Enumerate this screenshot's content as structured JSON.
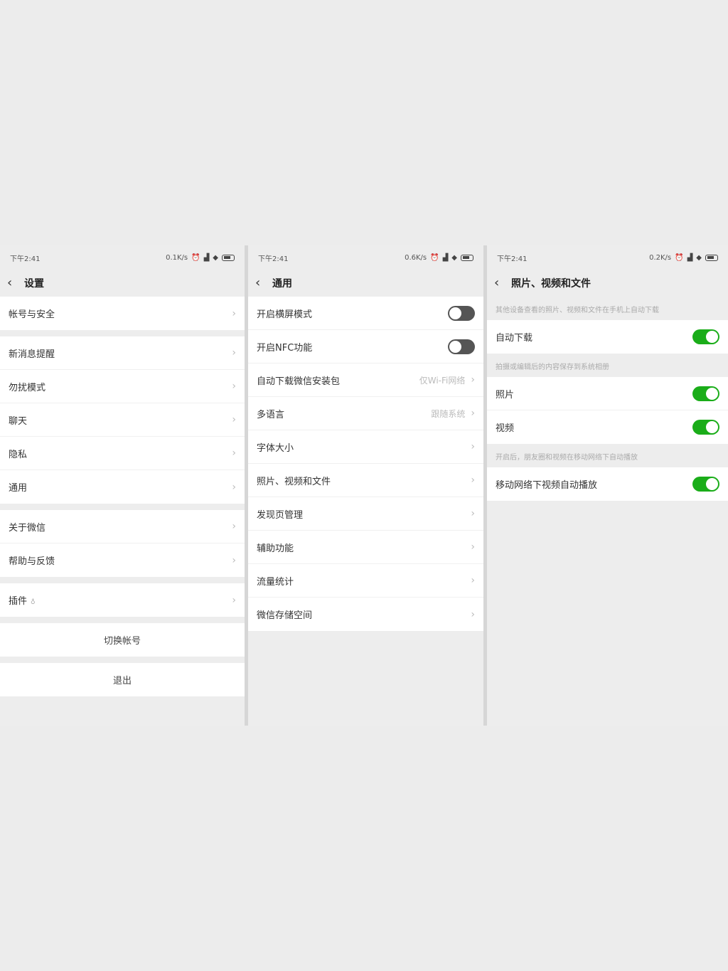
{
  "panel1": {
    "status": {
      "time": "下午2:41",
      "speed": "0.1K/s"
    },
    "nav": {
      "title": "设置"
    },
    "groups": [
      [
        "帐号与安全"
      ],
      [
        "新消息提醒",
        "勿扰模式",
        "聊天",
        "隐私",
        "通用"
      ],
      [
        "关于微信",
        "帮助与反馈"
      ],
      [
        "插件"
      ]
    ],
    "switch_account": "切换帐号",
    "logout": "退出"
  },
  "panel2": {
    "status": {
      "time": "下午2:41",
      "speed": "0.6K/s"
    },
    "nav": {
      "title": "通用"
    },
    "toggles": [
      {
        "label": "开启横屏模式",
        "state": "off"
      },
      {
        "label": "开启NFC功能",
        "state": "off"
      }
    ],
    "rows": [
      {
        "label": "自动下载微信安装包",
        "value": "仅Wi-Fi网络"
      },
      {
        "label": "多语言",
        "value": "跟随系统"
      },
      {
        "label": "字体大小",
        "value": ""
      },
      {
        "label": "照片、视频和文件",
        "value": ""
      },
      {
        "label": "发现页管理",
        "value": ""
      },
      {
        "label": "辅助功能",
        "value": ""
      },
      {
        "label": "流量统计",
        "value": ""
      },
      {
        "label": "微信存储空间",
        "value": ""
      }
    ]
  },
  "panel3": {
    "status": {
      "time": "下午2:41",
      "speed": "0.2K/s"
    },
    "nav": {
      "title": "照片、视频和文件"
    },
    "sections": [
      {
        "hint": "其他设备查看的照片、视频和文件在手机上自动下载",
        "items": [
          {
            "label": "自动下载",
            "state": "on"
          }
        ]
      },
      {
        "hint": "拍摄或编辑后的内容保存到系统相册",
        "items": [
          {
            "label": "照片",
            "state": "on"
          },
          {
            "label": "视频",
            "state": "on"
          }
        ]
      },
      {
        "hint": "开启后，朋友圈和视频在移动网络下自动播放",
        "items": [
          {
            "label": "移动网络下视频自动播放",
            "state": "on"
          }
        ]
      }
    ]
  },
  "icons": {
    "chevron": "chevron-right-icon",
    "back": "back-arrow-icon"
  },
  "colors": {
    "toggle_on": "#1aad19",
    "toggle_off": "#555555",
    "background": "#ededed"
  }
}
